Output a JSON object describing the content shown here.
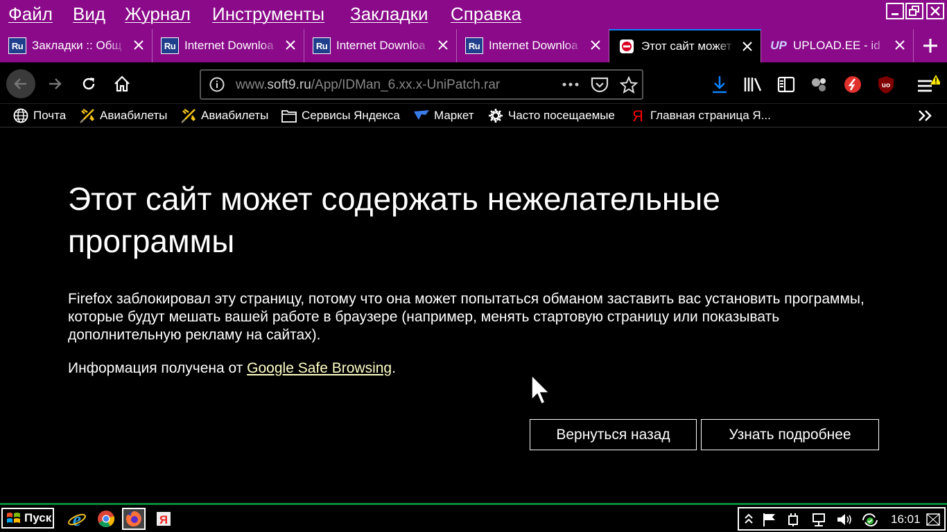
{
  "menubar": {
    "items": [
      {
        "label": "Файл"
      },
      {
        "label": "Вид"
      },
      {
        "label": "Журнал"
      },
      {
        "label": "Инструменты"
      },
      {
        "label": "Закладки"
      },
      {
        "label": "Справка"
      }
    ]
  },
  "tabs": [
    {
      "title": "Закладки :: Общ",
      "favicon": "ru-icon",
      "active": false
    },
    {
      "title": "Internet Downloa",
      "favicon": "ru-icon",
      "active": false
    },
    {
      "title": "Internet Downloa",
      "favicon": "ru-icon",
      "active": false
    },
    {
      "title": "Internet Downloa",
      "favicon": "ru-icon",
      "active": false
    },
    {
      "title": "Этот сайт может",
      "favicon": "blocked-site-icon",
      "active": true
    },
    {
      "title": "UPLOAD.EE - id",
      "favicon": "up-icon",
      "active": false
    }
  ],
  "favicon_labels": {
    "ru": "Ru",
    "up": "UP"
  },
  "urlbar": {
    "domain_prefix": "www.",
    "domain": "soft9.ru",
    "path": "/App/IDMan_6.xx.x-UniPatch.rar"
  },
  "bookmarks": [
    {
      "label": "Почта",
      "icon": "globe-icon"
    },
    {
      "label": "Авиабилеты",
      "icon": "plane-icon"
    },
    {
      "label": "Авиабилеты",
      "icon": "plane-icon"
    },
    {
      "label": "Сервисы Яндекса",
      "icon": "folder-icon"
    },
    {
      "label": "Маркет",
      "icon": "market-icon"
    },
    {
      "label": "Часто посещаемые",
      "icon": "gear-icon"
    },
    {
      "label": "Главная страница Я...",
      "icon": "yandex-icon"
    }
  ],
  "page": {
    "title": "Этот сайт может содержать нежелательные программы",
    "description": "Firefox заблокировал эту страницу, потому что она может попытаться обманом заставить вас установить программы, которые будут мешать вашей работе в браузере (например, менять стартовую страницу или показывать дополнительную рекламу на сайтах).",
    "info_prefix": "Информация получена от ",
    "info_link": "Google Safe Browsing",
    "info_suffix": ".",
    "back_button": "Вернуться назад",
    "learn_more_button": "Узнать подробнее"
  },
  "taskbar": {
    "start_label": "Пуск",
    "apps": [
      "ie-icon",
      "chrome-icon",
      "firefox-icon",
      "yandex-browser-icon"
    ],
    "clock": "16:01"
  },
  "colors": {
    "menubar_bg": "#8a0a8a",
    "active_tab_accent": "#0a84ff",
    "taskbar_accent": "#0b8a3a",
    "link": "#ffffc8"
  }
}
